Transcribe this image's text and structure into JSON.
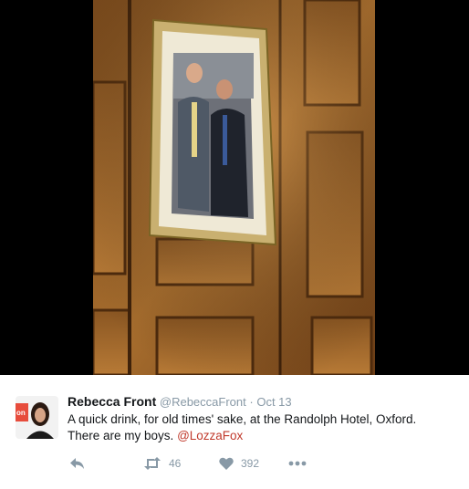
{
  "tweet": {
    "display_name": "Rebecca Front",
    "handle": "@RebeccaFront",
    "separator": "·",
    "date": "Oct 13",
    "text_line1": "A quick drink, for old times' sake, at the Randolph Hotel, Oxford.",
    "text_line2": "There are my boys.",
    "mention": "@LozzaFox",
    "retweets": "46",
    "likes": "392"
  },
  "icons": {
    "reply": "reply-icon",
    "retweet": "retweet-icon",
    "like": "heart-icon",
    "more": "more-icon"
  },
  "colors": {
    "mention": "#c0392b",
    "meta": "#8899a6",
    "text": "#14171a"
  }
}
